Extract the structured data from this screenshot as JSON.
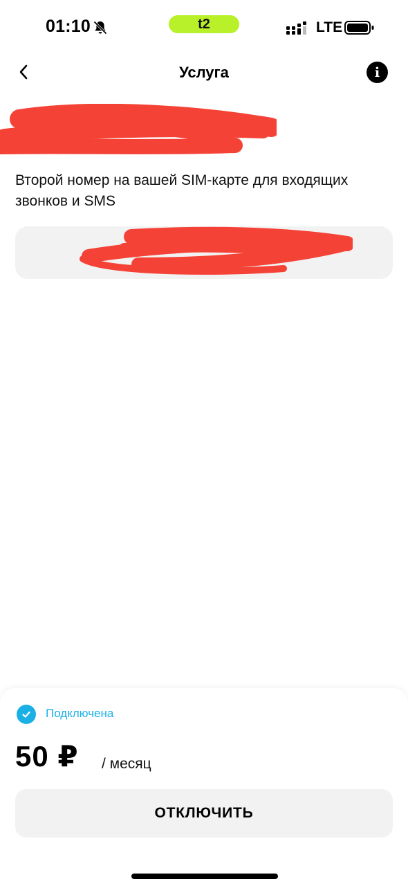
{
  "status_bar": {
    "time": "01:10",
    "carrier": "t2",
    "network": "LTE",
    "icons": [
      "bell-muted-icon",
      "signal-icon",
      "battery-icon"
    ],
    "carrier_color": "#b8f02a"
  },
  "header": {
    "title": "Услуга",
    "back_icon": "chevron-left-icon",
    "info_icon": "info-icon",
    "info_label": "i"
  },
  "service": {
    "title": "Второй номер",
    "description": "Второй номер на вашей SIM-карте для входящих звонков и SMS",
    "number": ""
  },
  "bottom": {
    "status": "Подключена",
    "status_color": "#1ab0e6",
    "price": "50 ₽",
    "period": "/ месяц",
    "disconnect_label": "ОТКЛЮЧИТЬ"
  },
  "colors": {
    "accent": "#1ab0e6",
    "redaction": "#f44336",
    "card_bg": "#f2f2f2"
  }
}
